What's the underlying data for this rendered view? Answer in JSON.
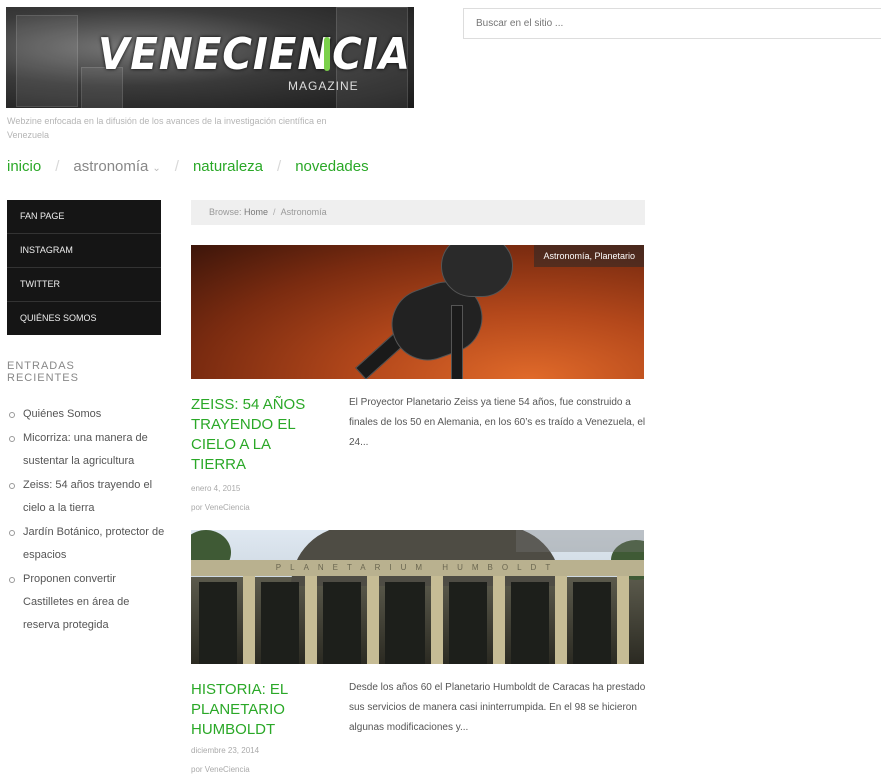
{
  "header": {
    "logo_title": "VENECIENCIA",
    "logo_subtitle": "MAGAZINE",
    "tagline": "Webzine enfocada en la difusión de los avances de la investigación científica en Venezuela"
  },
  "search": {
    "placeholder": "Buscar en el sitio ..."
  },
  "nav": {
    "items": [
      {
        "label": "inicio"
      },
      {
        "label": "astronomía",
        "has_dropdown": true
      },
      {
        "label": "naturaleza"
      },
      {
        "label": "novedades"
      }
    ],
    "separator": "/"
  },
  "sidebar": {
    "social": [
      "FAN PAGE",
      "INSTAGRAM",
      "TWITTER",
      "QUIÉNES SOMOS"
    ],
    "recent_title": "ENTRADAS RECIENTES",
    "recent": [
      "Quiénes Somos",
      "Micorriza: una manera de sustentar la agricultura",
      "Zeiss: 54 años trayendo el cielo a la tierra",
      "Jardín Botánico, protector de espacios",
      "Proponen convertir Castilletes en área de reserva protegida"
    ]
  },
  "breadcrumb": {
    "prefix": "Browse:",
    "home": "Home",
    "current": "Astronomía",
    "sep": "/"
  },
  "posts": [
    {
      "categories": "Astronomía, Planetario",
      "title": "ZEISS: 54 AÑOS TRAYENDO EL CIELO A LA TIERRA",
      "date": "enero 4, 2015",
      "author_prefix": "por",
      "author": "VeneCiencia",
      "excerpt": "El Proyector Planetario Zeiss ya tiene 54 años, fue construido a finales de los 50 en Alemania, en los 60’s es traído a Venezuela, el 24..."
    },
    {
      "categories": "",
      "title": "HISTORIA: EL PLANETARIO HUMBOLDT",
      "date": "diciembre 23, 2014",
      "author_prefix": "por",
      "author": "VeneCiencia",
      "excerpt": "Desde los años 60 el Planetario Humboldt de Caracas ha prestado sus servicios de manera casi ininterrumpida. En el 98 se hicieron algunas modificaciones y...",
      "image_caption": "PLANETARIUM HUMBOLDT"
    }
  ],
  "colors": {
    "accent_green": "#2aa827",
    "sidebar_dark": "#151515"
  }
}
